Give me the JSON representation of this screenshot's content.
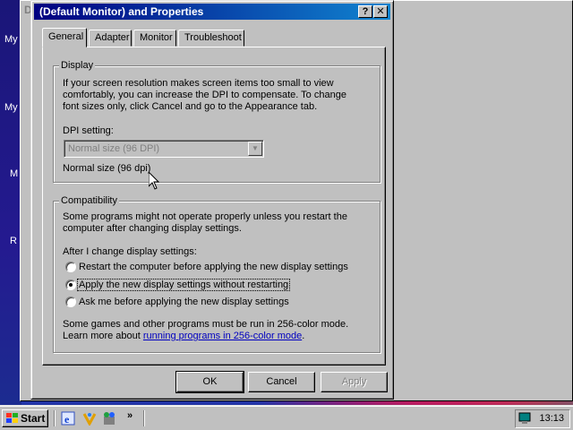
{
  "desktop": {
    "icons": [
      "My",
      "My",
      "M",
      "R"
    ]
  },
  "background_window": {
    "title_initial": "D"
  },
  "dialog": {
    "title": "(Default Monitor) and  Properties",
    "help_glyph": "?",
    "close_glyph": "✕",
    "tabs": [
      {
        "label": "General",
        "active": true
      },
      {
        "label": "Adapter",
        "active": false
      },
      {
        "label": "Monitor",
        "active": false
      },
      {
        "label": "Troubleshoot",
        "active": false
      }
    ],
    "display_group": {
      "label": "Display",
      "description_lines": [
        "If your screen resolution makes screen items too small to view",
        "comfortably, you can increase the DPI to compensate.  To change",
        "font sizes only, click Cancel and go to the Appearance tab."
      ],
      "dpi_label": "DPI setting:",
      "dpi_selected": "Normal size (96 DPI)",
      "dpi_status": "Normal size (96 dpi)"
    },
    "compatibility_group": {
      "label": "Compatibility",
      "description_lines": [
        "Some programs might not operate properly unless you restart the",
        "computer after changing display settings."
      ],
      "after_change_label": "After I change display settings:",
      "options": [
        {
          "label": "Restart the computer before applying the new display settings",
          "checked": false
        },
        {
          "label": "Apply the new display settings without restarting",
          "checked": true
        },
        {
          "label": "Ask me before applying the new display settings",
          "checked": false
        }
      ],
      "footer_line1": "Some games and other programs must be run in 256-color mode.",
      "footer_line2_prefix": "Learn more about ",
      "footer_link": "running programs in 256-color mode",
      "footer_line2_suffix": "."
    },
    "buttons": {
      "ok": "OK",
      "cancel": "Cancel",
      "apply": "Apply"
    }
  },
  "taskbar": {
    "start_label": "Start",
    "quicklaunch": [
      "internet-explorer-icon",
      "outlook-express-icon",
      "channels-icon"
    ],
    "overflow": "»",
    "clock": "13:13"
  },
  "colors": {
    "titlebar_start": "#000080",
    "titlebar_end": "#1084d0",
    "link": "#0000c0",
    "face": "#c0c0c0"
  }
}
